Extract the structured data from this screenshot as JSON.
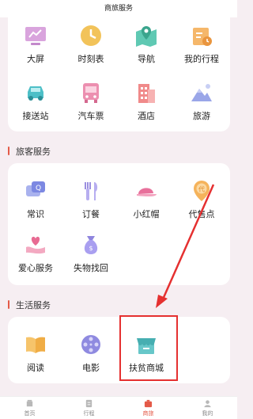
{
  "header": {
    "title": "商旅服务"
  },
  "top_services": [
    {
      "label": "大屏",
      "icon": "monitor-icon"
    },
    {
      "label": "时刻表",
      "icon": "clock-icon"
    },
    {
      "label": "导航",
      "icon": "map-icon"
    },
    {
      "label": "我的行程",
      "icon": "calendar-icon"
    },
    {
      "label": "接送站",
      "icon": "car-icon"
    },
    {
      "label": "汽车票",
      "icon": "bus-icon"
    },
    {
      "label": "酒店",
      "icon": "hotel-icon"
    },
    {
      "label": "旅游",
      "icon": "mountain-icon"
    }
  ],
  "passenger": {
    "title": "旅客服务",
    "items": [
      {
        "label": "常识",
        "icon": "chat-icon"
      },
      {
        "label": "订餐",
        "icon": "cutlery-icon"
      },
      {
        "label": "小红帽",
        "icon": "cap-icon"
      },
      {
        "label": "代售点",
        "icon": "location-pin-icon"
      },
      {
        "label": "爱心服务",
        "icon": "heart-hand-icon"
      },
      {
        "label": "失物找回",
        "icon": "money-bag-icon"
      }
    ]
  },
  "life": {
    "title": "生活服务",
    "items": [
      {
        "label": "阅读",
        "icon": "book-icon"
      },
      {
        "label": "电影",
        "icon": "film-reel-icon"
      },
      {
        "label": "扶贫商城",
        "icon": "shop-icon"
      }
    ]
  },
  "tabs": [
    {
      "label": "首页",
      "icon": "home-icon"
    },
    {
      "label": "行程",
      "icon": "itinerary-icon"
    },
    {
      "label": "商旅",
      "icon": "briefcase-icon"
    },
    {
      "label": "我的",
      "icon": "user-icon"
    }
  ],
  "colors": {
    "accent": "#e45a48",
    "annotation": "#e53030",
    "background": "#f6eef2"
  }
}
